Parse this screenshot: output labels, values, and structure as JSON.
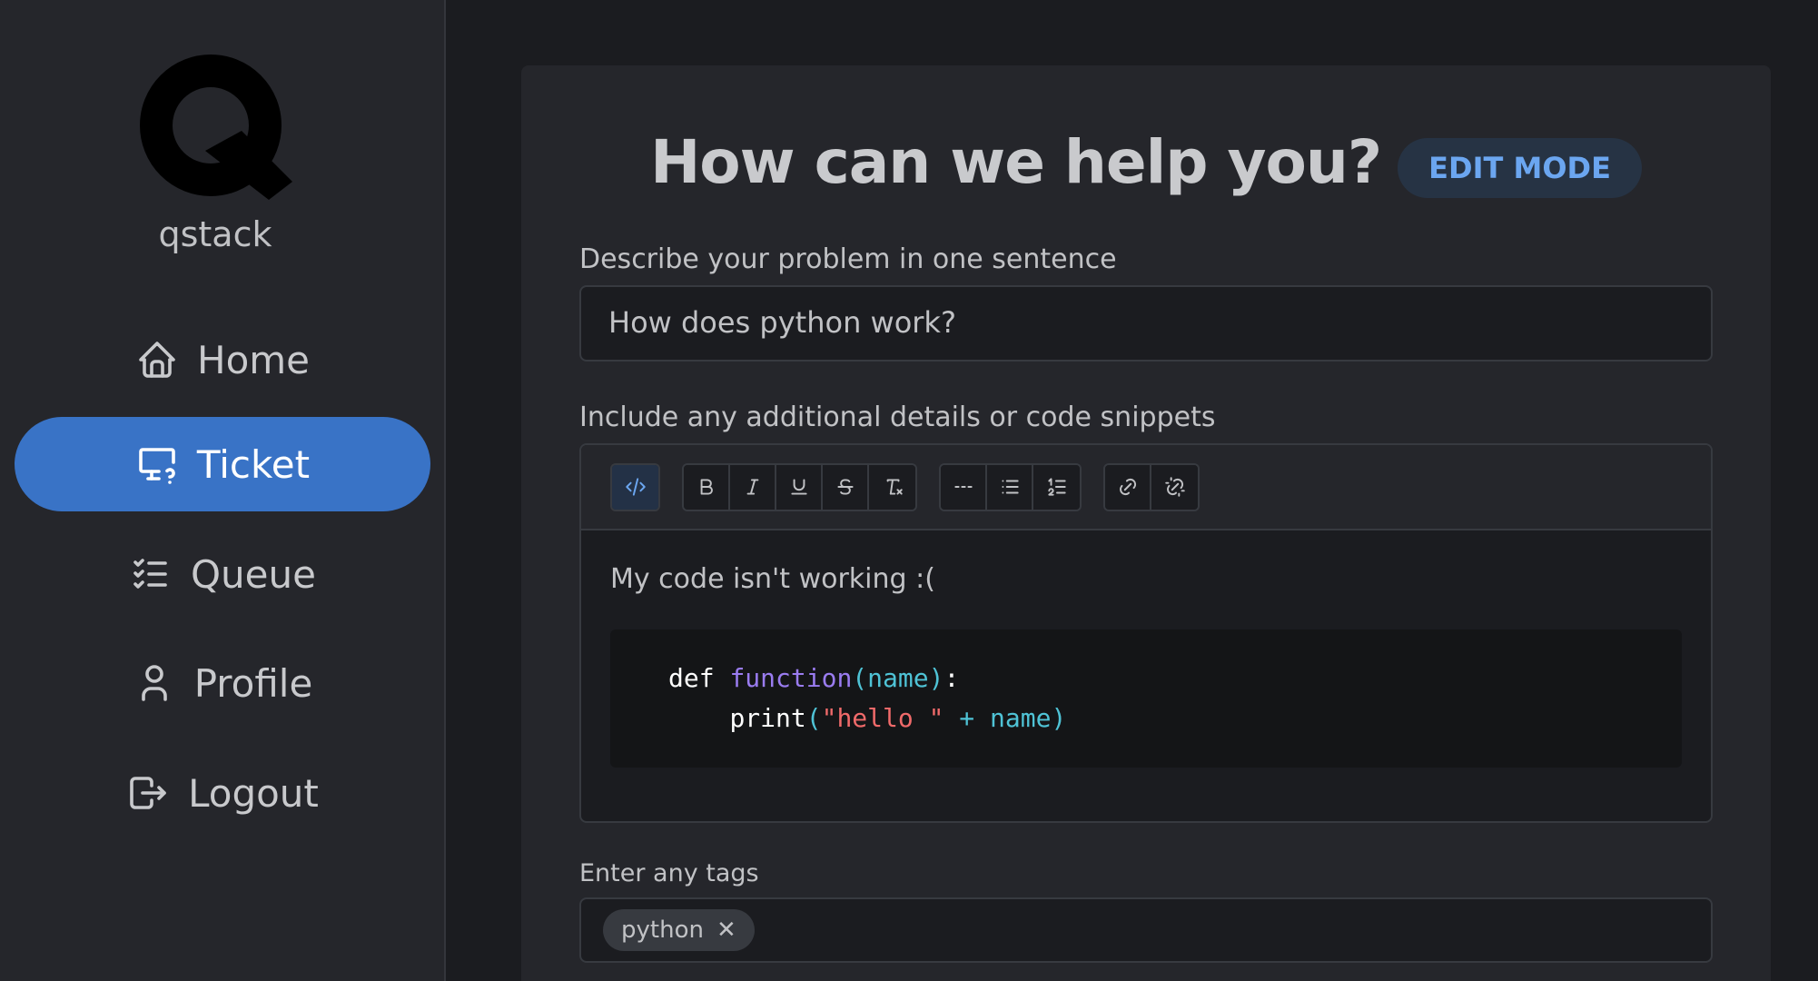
{
  "app": {
    "brand": "qstack",
    "logo_letter": "Q"
  },
  "sidebar": {
    "items": [
      {
        "label": "Home",
        "icon": "home-icon",
        "active": false
      },
      {
        "label": "Ticket",
        "icon": "monitor-question-icon",
        "active": true
      },
      {
        "label": "Queue",
        "icon": "list-check-icon",
        "active": false
      },
      {
        "label": "Profile",
        "icon": "user-icon",
        "active": false
      },
      {
        "label": "Logout",
        "icon": "logout-icon",
        "active": false
      }
    ]
  },
  "main": {
    "title": "How can we help you?",
    "mode_badge": "EDIT MODE",
    "summary": {
      "label": "Describe your problem in one sentence",
      "value": "How does python work?"
    },
    "details": {
      "label": "Include any additional details or code snippets",
      "toolbar": [
        [
          "code-icon"
        ],
        [
          "bold-icon",
          "italic-icon",
          "underline-icon",
          "strikethrough-icon",
          "clear-formatting-icon"
        ],
        [
          "horizontal-rule-icon",
          "bullet-list-icon",
          "ordered-list-icon"
        ],
        [
          "link-icon",
          "unlink-icon"
        ]
      ],
      "text": "My code isn't working :(",
      "code": {
        "def": "def",
        "fn": "function",
        "open": "(",
        "param": "name",
        "close": ")",
        "colon": ":",
        "print": "print",
        "str": "\"hello \"",
        "plus": " + ",
        "var": "name"
      }
    },
    "tags": {
      "label": "Enter any tags",
      "items": [
        "python"
      ],
      "remove_glyph": "✕"
    }
  },
  "colors": {
    "accent": "#3973c6",
    "badge_text": "#6ba6f0",
    "background": "#1b1c20",
    "panel": "#25262b"
  }
}
